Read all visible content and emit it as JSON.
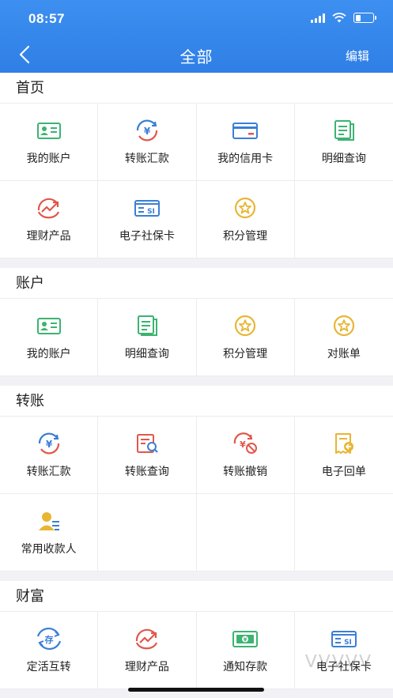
{
  "status_bar": {
    "time": "08:57"
  },
  "header": {
    "title": "全部",
    "edit_label": "编辑"
  },
  "sections": [
    {
      "title": "首页",
      "items": [
        {
          "label": "我的账户",
          "icon": "id-card-icon"
        },
        {
          "label": "转账汇款",
          "icon": "yuan-transfer-icon"
        },
        {
          "label": "我的信用卡",
          "icon": "credit-card-icon"
        },
        {
          "label": "明细查询",
          "icon": "document-list-icon"
        },
        {
          "label": "理财产品",
          "icon": "trend-chart-icon"
        },
        {
          "label": "电子社保卡",
          "icon": "social-security-card-icon"
        },
        {
          "label": "积分管理",
          "icon": "star-coin-icon"
        }
      ]
    },
    {
      "title": "账户",
      "items": [
        {
          "label": "我的账户",
          "icon": "id-card-icon"
        },
        {
          "label": "明细查询",
          "icon": "document-list-icon"
        },
        {
          "label": "积分管理",
          "icon": "star-coin-icon"
        },
        {
          "label": "对账单",
          "icon": "star-coin-icon"
        }
      ]
    },
    {
      "title": "转账",
      "items": [
        {
          "label": "转账汇款",
          "icon": "yuan-transfer-icon"
        },
        {
          "label": "转账查询",
          "icon": "transfer-search-icon"
        },
        {
          "label": "转账撤销",
          "icon": "transfer-cancel-icon"
        },
        {
          "label": "电子回单",
          "icon": "receipt-icon"
        },
        {
          "label": "常用收款人",
          "icon": "payee-icon"
        }
      ]
    },
    {
      "title": "财富",
      "items": [
        {
          "label": "定活互转",
          "icon": "deposit-exchange-icon"
        },
        {
          "label": "理财产品",
          "icon": "trend-chart-icon"
        },
        {
          "label": "通知存款",
          "icon": "cash-note-icon"
        },
        {
          "label": "电子社保卡",
          "icon": "social-security-card-icon"
        }
      ]
    }
  ],
  "watermark": "ᐯᐯᐯᐯᐯ",
  "colors": {
    "header_blue": "#3a8bee",
    "icon_blue": "#3a7fd5",
    "icon_green": "#3cb371",
    "icon_red": "#e2574c",
    "icon_gold": "#e8b634"
  }
}
